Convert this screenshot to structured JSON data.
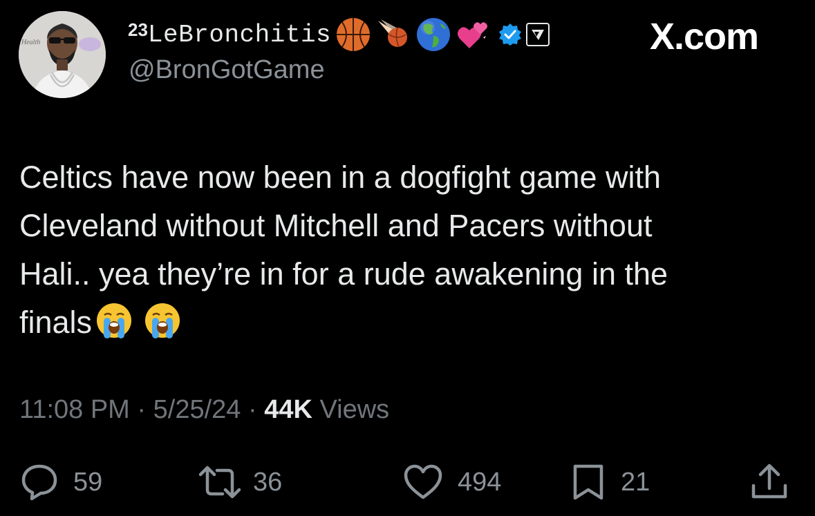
{
  "user": {
    "jersey_number": "23",
    "display_name": "LeBronchitis",
    "handle": "@BronGotGame",
    "name_emojis": [
      "basketball-icon",
      "comet-ball-icon",
      "globe-americas-icon",
      "two-hearts-icon"
    ],
    "verified_color": "#1d9bf0"
  },
  "brand": {
    "label": "X.com"
  },
  "tweet": {
    "lines": [
      "Celtics have now been in a dogfight game with",
      "Cleveland without Mitchell and Pacers without",
      "Hali.. yea they’re in for a rude awakening in the",
      "finals"
    ],
    "trailing_emojis": [
      "loudly-crying-face-icon",
      "loudly-crying-face-icon"
    ]
  },
  "meta": {
    "time": "11:08 PM",
    "separator": "·",
    "date": "5/25/24",
    "views_count": "44K",
    "views_label": "Views"
  },
  "actions": {
    "replies": "59",
    "reposts": "36",
    "likes": "494",
    "bookmarks": "21"
  },
  "colors": {
    "background": "#000000",
    "text": "#e7e9ea",
    "secondary": "#71767b"
  }
}
